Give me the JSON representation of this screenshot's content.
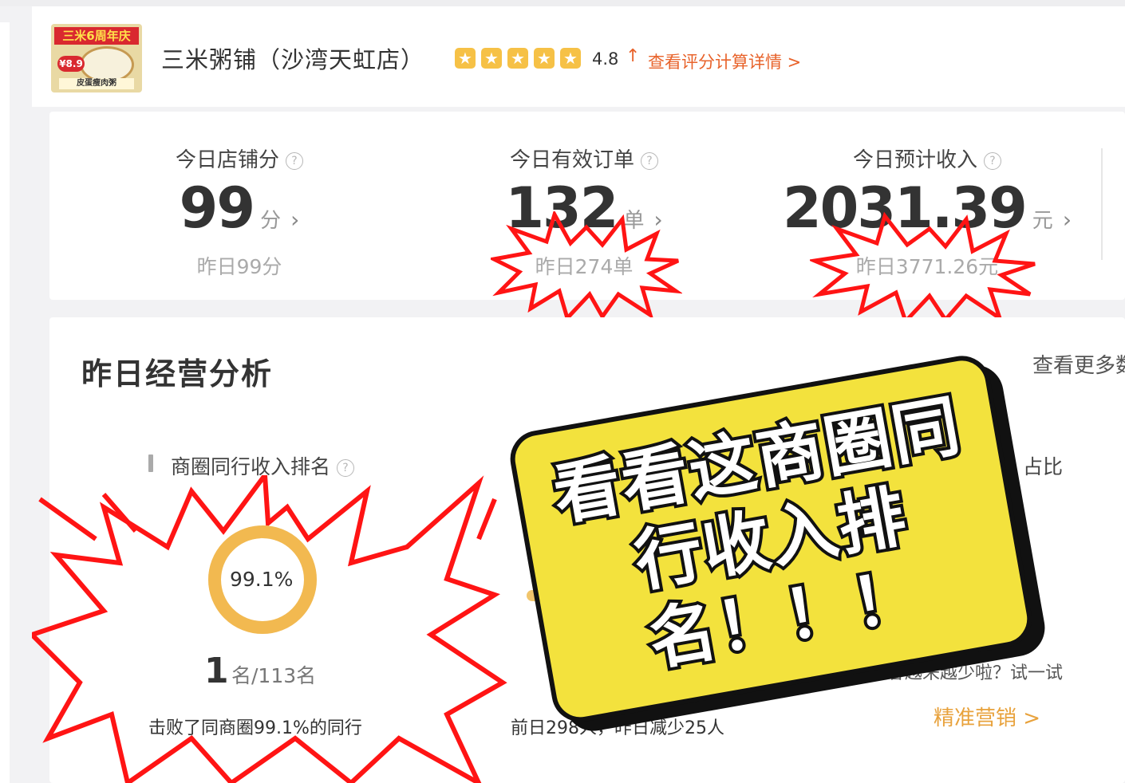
{
  "shop": {
    "logo": {
      "banner": "三米6周年庆",
      "price": "¥8.9",
      "caption": "皮蛋瘦肉粥"
    },
    "name": "三米粥铺（沙湾天虹店）",
    "rating": "4.8",
    "rating_trend": "↑",
    "rating_link": "查看评分计算详情 >"
  },
  "today": [
    {
      "label": "今日店铺分",
      "value": "99",
      "unit": "分",
      "sub": "昨日99分"
    },
    {
      "label": "今日有效订单",
      "value": "132",
      "unit": "单",
      "sub": "昨日274单"
    },
    {
      "label": "今日预计收入",
      "value": "2031.39",
      "unit": "元",
      "sub": "昨日3771.26元"
    }
  ],
  "analysis": {
    "title": "昨日经营分析",
    "more": "查看更多数",
    "rank_section": "商圈同行收入排名",
    "ring_percent_label": "99.1%",
    "ring_percent": 0.991,
    "rank_no": "1",
    "rank_of": "名/113名",
    "beat_text": "击败了同商圈99.1%的同行",
    "prev_day_text": "前日298人，昨日减少25人",
    "right_section_tail": "占比",
    "tip": "顾客越来越少啦？试一试",
    "marketing": "精准营销 >"
  },
  "sticker": {
    "line1": "看看这商圈同",
    "line2": "行收入排",
    "line3": "名！！！"
  },
  "colors": {
    "accent": "#e8632b",
    "star": "#f6c146",
    "burst": "#ff1414",
    "sticker_fill": "#f3e23d",
    "ring": "#f2b950",
    "marketing": "#e8a23c"
  }
}
